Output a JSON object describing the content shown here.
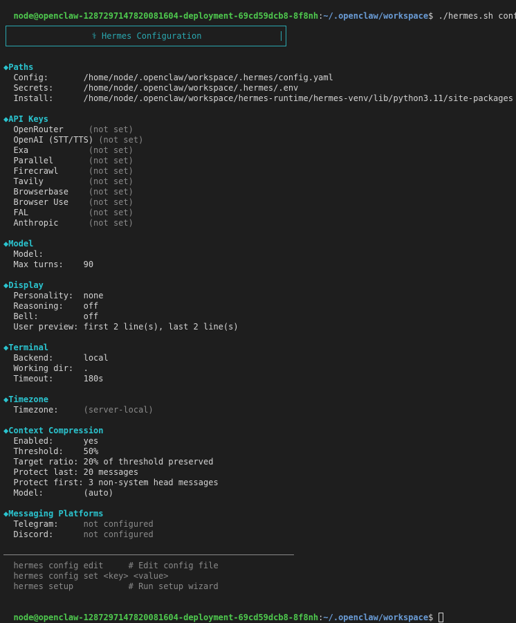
{
  "prompt": {
    "user_host": "node@openclaw-1287297147820081604-deployment-69cd59dcb8-8f8nh",
    "separator": ":",
    "path": "~/.openclaw/workspace",
    "dollar": "$ ",
    "command": "./hermes.sh config"
  },
  "banner": {
    "title": "⚕ Hermes Configuration"
  },
  "sections": {
    "paths": {
      "title": "Paths",
      "rows": [
        {
          "label": "Config:       ",
          "value": "/home/node/.openclaw/workspace/.hermes/config.yaml"
        },
        {
          "label": "Secrets:      ",
          "value": "/home/node/.openclaw/workspace/.hermes/.env"
        },
        {
          "label": "Install:      ",
          "value": "/home/node/.openclaw/workspace/hermes-runtime/hermes-venv/lib/python3.11/site-packages"
        }
      ]
    },
    "api_keys": {
      "title": "API Keys",
      "rows": [
        {
          "label": "OpenRouter     ",
          "value": "(not set)"
        },
        {
          "label": "OpenAI (STT/TTS) ",
          "value": "(not set)"
        },
        {
          "label": "Exa            ",
          "value": "(not set)"
        },
        {
          "label": "Parallel       ",
          "value": "(not set)"
        },
        {
          "label": "Firecrawl      ",
          "value": "(not set)"
        },
        {
          "label": "Tavily         ",
          "value": "(not set)"
        },
        {
          "label": "Browserbase    ",
          "value": "(not set)"
        },
        {
          "label": "Browser Use    ",
          "value": "(not set)"
        },
        {
          "label": "FAL            ",
          "value": "(not set)"
        },
        {
          "label": "Anthropic      ",
          "value": "(not set)"
        }
      ]
    },
    "model": {
      "title": "Model",
      "rows": [
        {
          "label": "Model:",
          "value": ""
        },
        {
          "label": "Max turns:    ",
          "value": "90"
        }
      ]
    },
    "display": {
      "title": "Display",
      "rows": [
        {
          "label": "Personality:  ",
          "value": "none"
        },
        {
          "label": "Reasoning:    ",
          "value": "off"
        },
        {
          "label": "Bell:         ",
          "value": "off"
        },
        {
          "label": "User preview: ",
          "value": "first 2 line(s), last 2 line(s)"
        }
      ]
    },
    "terminal": {
      "title": "Terminal",
      "rows": [
        {
          "label": "Backend:      ",
          "value": "local"
        },
        {
          "label": "Working dir:  ",
          "value": "."
        },
        {
          "label": "Timeout:      ",
          "value": "180s"
        }
      ]
    },
    "timezone": {
      "title": "Timezone",
      "rows": [
        {
          "label": "Timezone:     ",
          "value": "(server-local)"
        }
      ]
    },
    "context": {
      "title": "Context Compression",
      "rows": [
        {
          "label": "Enabled:      ",
          "value": "yes"
        },
        {
          "label": "Threshold:    ",
          "value": "50%"
        },
        {
          "label": "Target ratio: ",
          "value": "20% of threshold preserved"
        },
        {
          "label": "Protect last: ",
          "value": "20 messages"
        },
        {
          "label": "Protect first: ",
          "value": "3 non-system head messages"
        },
        {
          "label": "Model:        ",
          "value": "(auto)"
        }
      ]
    },
    "messaging": {
      "title": "Messaging Platforms",
      "rows": [
        {
          "label": "Telegram:     ",
          "value": "not configured"
        },
        {
          "label": "Discord:      ",
          "value": "not configured"
        }
      ]
    }
  },
  "help": [
    {
      "cmd": "hermes config edit     ",
      "comment": "# Edit config file"
    },
    {
      "cmd": "hermes config set <key> <value>",
      "comment": ""
    },
    {
      "cmd": "hermes setup           ",
      "comment": "# Run setup wizard"
    }
  ],
  "diamond_glyph": "◆"
}
